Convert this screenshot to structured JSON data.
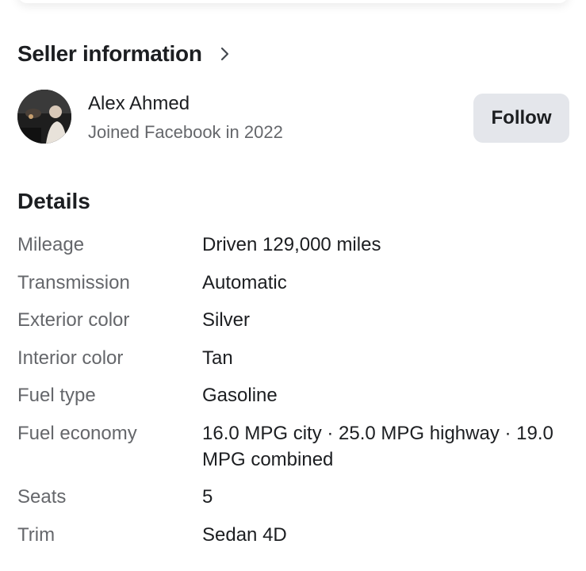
{
  "seller_section": {
    "title": "Seller information",
    "seller_name": "Alex Ahmed",
    "joined": "Joined Facebook in 2022",
    "follow_label": "Follow"
  },
  "details": {
    "title": "Details",
    "rows": [
      {
        "label": "Mileage",
        "value": "Driven 129,000 miles"
      },
      {
        "label": "Transmission",
        "value": "Automatic"
      },
      {
        "label": "Exterior color",
        "value": "Silver"
      },
      {
        "label": "Interior color",
        "value": "Tan"
      },
      {
        "label": "Fuel type",
        "value": "Gasoline"
      },
      {
        "label": "Fuel economy",
        "value": "16.0 MPG city · 25.0 MPG highway · 19.0 MPG combined"
      },
      {
        "label": "Seats",
        "value": "5"
      },
      {
        "label": "Trim",
        "value": "Sedan 4D"
      }
    ]
  },
  "icons": {
    "chevron": "chevron-right-icon",
    "avatar": "profile-photo"
  },
  "colors": {
    "text_primary": "#1c1e21",
    "text_secondary": "#65676b",
    "button_bg": "#e4e6eb"
  }
}
